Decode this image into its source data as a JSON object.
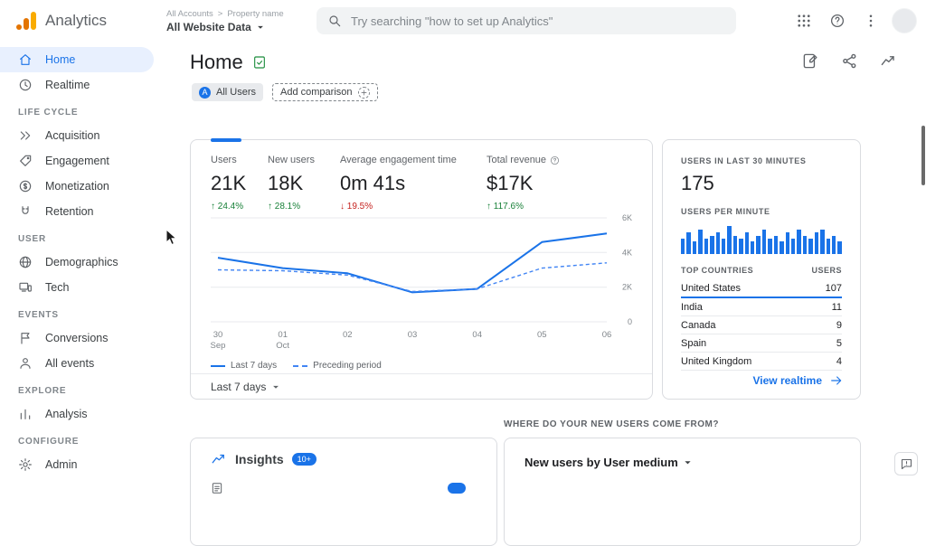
{
  "accent": "#1a73e8",
  "header": {
    "app_name": "Analytics",
    "breadcrumb": {
      "account": "All Accounts",
      "separator": ">",
      "property": "Property name"
    },
    "property_selector": "All Website Data",
    "search_placeholder": "Try searching \"how to set up Analytics\""
  },
  "sidebar": {
    "rows": [
      {
        "type": "item",
        "name": "home",
        "label": "Home",
        "active": true
      },
      {
        "type": "item",
        "name": "realtime",
        "label": "Realtime"
      },
      {
        "type": "section",
        "label": "LIFE CYCLE"
      },
      {
        "type": "item",
        "name": "acquisition",
        "label": "Acquisition"
      },
      {
        "type": "item",
        "name": "engagement",
        "label": "Engagement"
      },
      {
        "type": "item",
        "name": "monetization",
        "label": "Monetization"
      },
      {
        "type": "item",
        "name": "retention",
        "label": "Retention"
      },
      {
        "type": "section",
        "label": "USER"
      },
      {
        "type": "item",
        "name": "demographics",
        "label": "Demographics"
      },
      {
        "type": "item",
        "name": "tech",
        "label": "Tech"
      },
      {
        "type": "section",
        "label": "EVENTS"
      },
      {
        "type": "item",
        "name": "conversions",
        "label": "Conversions"
      },
      {
        "type": "item",
        "name": "all-events",
        "label": "All events"
      },
      {
        "type": "section",
        "label": "EXPLORE"
      },
      {
        "type": "item",
        "name": "analysis",
        "label": "Analysis"
      },
      {
        "type": "section",
        "label": "CONFIGURE"
      },
      {
        "type": "item",
        "name": "admin",
        "label": "Admin"
      }
    ]
  },
  "page": {
    "title": "Home",
    "chips": {
      "all_users_initial": "A",
      "all_users": "All Users",
      "add_comparison": "Add comparison"
    }
  },
  "overview": {
    "metrics": [
      {
        "label": "Users",
        "value": "21K",
        "arrow": "↑",
        "delta": "24.4%",
        "direction": "up"
      },
      {
        "label": "New users",
        "value": "18K",
        "arrow": "↑",
        "delta": "28.1%",
        "direction": "up"
      },
      {
        "label": "Average engagement time",
        "value": "0m 41s",
        "arrow": "↓",
        "delta": "19.5%",
        "direction": "down"
      },
      {
        "label": "Total revenue",
        "value": "$17K",
        "arrow": "↑",
        "delta": "117.6%",
        "direction": "up",
        "has_info": true
      }
    ],
    "legend": [
      "Last 7 days",
      "Preceding period"
    ],
    "range_selector": "Last 7 days"
  },
  "realtime": {
    "users_last_30_label": "USERS IN LAST 30 MINUTES",
    "users_last_30_value": "175",
    "per_minute_label": "USERS PER MINUTE",
    "countries_header": {
      "name": "TOP COUNTRIES",
      "value": "USERS"
    },
    "top_countries": [
      {
        "name": "United States",
        "users": 107
      },
      {
        "name": "India",
        "users": 11
      },
      {
        "name": "Canada",
        "users": 9
      },
      {
        "name": "Spain",
        "users": 5
      },
      {
        "name": "United Kingdom",
        "users": 4
      }
    ],
    "view_realtime": "View realtime"
  },
  "bottom": {
    "section_heading": "WHERE DO YOUR NEW USERS COME FROM?",
    "insights": {
      "title": "Insights",
      "badge": "10+"
    },
    "new_users_card": {
      "title": "New users by User medium"
    }
  },
  "chart_data": [
    {
      "type": "line",
      "title": "Users over time",
      "x": [
        "30 Sep",
        "01 Oct",
        "02",
        "03",
        "04",
        "05",
        "06"
      ],
      "x_day": [
        "30",
        "01",
        "02",
        "03",
        "04",
        "05",
        "06"
      ],
      "x_month": [
        "Sep",
        "Oct",
        "",
        "",
        "",
        "",
        ""
      ],
      "series": [
        {
          "name": "Last 7 days",
          "style": "solid",
          "values": [
            3700,
            3100,
            2800,
            1700,
            1900,
            4600,
            5100
          ]
        },
        {
          "name": "Preceding period",
          "style": "dashed",
          "values": [
            3000,
            2950,
            2700,
            1750,
            1900,
            3100,
            3400
          ]
        }
      ],
      "ylim": [
        0,
        6000
      ],
      "ytick_values": [
        0,
        2000,
        4000,
        6000
      ],
      "yticks": [
        "0",
        "2K",
        "4K",
        "6K"
      ],
      "legend_position": "bottom",
      "grid": true
    },
    {
      "type": "bar",
      "title": "Users per minute",
      "values": [
        5,
        7,
        4,
        8,
        5,
        6,
        7,
        5,
        9,
        6,
        5,
        7,
        4,
        6,
        8,
        5,
        6,
        4,
        7,
        5,
        8,
        6,
        5,
        7,
        8,
        5,
        6,
        4
      ],
      "ylim": [
        0,
        10
      ]
    }
  ]
}
